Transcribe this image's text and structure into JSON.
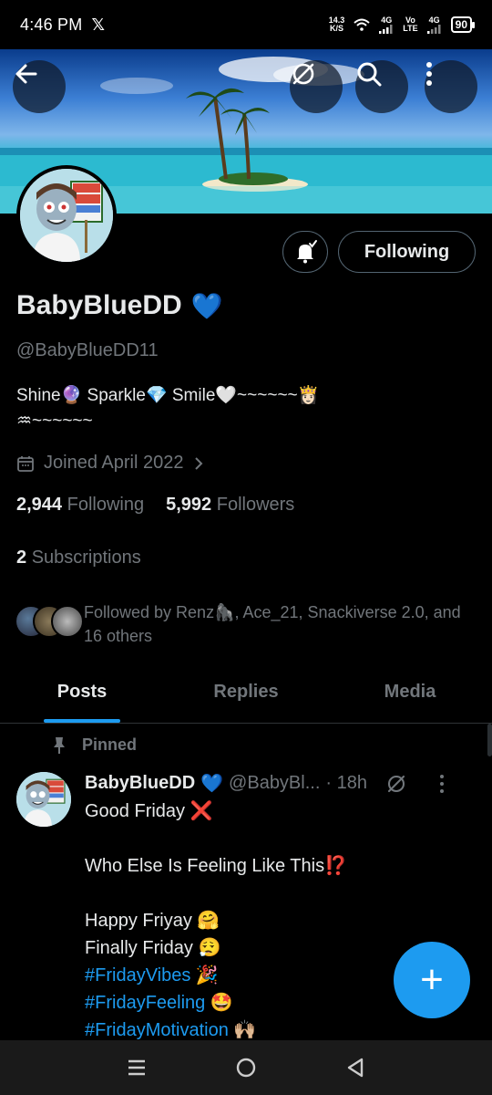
{
  "status": {
    "time": "4:46 PM",
    "x_logo": "𝕏",
    "speed_top": "14.3",
    "speed_unit": "K/S",
    "net1": "4G",
    "volte_top": "Vo",
    "volte_bottom": "LTE",
    "net2": "4G",
    "battery": "90"
  },
  "header": {
    "icons": [
      "back-arrow-icon",
      "grok-icon",
      "search-icon",
      "more-vertical-icon"
    ]
  },
  "profile": {
    "name": "BabyBlueDD",
    "verified_emoji": "💙",
    "handle": "@BabyBlueDD11",
    "bio_line1": "Shine🔮 Sparkle💎 Smile🤍~~~~~~👸🏻",
    "bio_line2": "♒~~~~~~",
    "joined": "Joined April 2022",
    "following_count": "2,944",
    "following_label": "Following",
    "followers_count": "5,992",
    "followers_label": "Followers",
    "subscriptions_count": "2",
    "subscriptions_label": "Subscriptions",
    "followed_by": "Followed by Renz🦍, Ace_21, Snackiverse 2.0, and 16 others",
    "following_button": "Following"
  },
  "tabs": [
    {
      "label": "Posts",
      "active": true
    },
    {
      "label": "Replies",
      "active": false
    },
    {
      "label": "Media",
      "active": false
    }
  ],
  "post": {
    "pinned_label": "Pinned",
    "author": "BabyBlueDD",
    "verified_emoji": "💙",
    "handle": "@BabyBl...",
    "time": "· 18h",
    "lines": [
      "Good Friday ❌",
      "",
      "Who Else Is Feeling Like This⁉️",
      "",
      "Happy Friyay 🤗",
      "Finally Friday 😮‍💨"
    ],
    "hashtags": [
      "#FridayVibes 🎉",
      "#FridayFeeling 🤩",
      "#FridayMotivation 🙌🏼"
    ]
  },
  "fab_label": "+",
  "colors": {
    "accent": "#1d9bf0",
    "background": "#000000",
    "muted": "#71767b"
  }
}
